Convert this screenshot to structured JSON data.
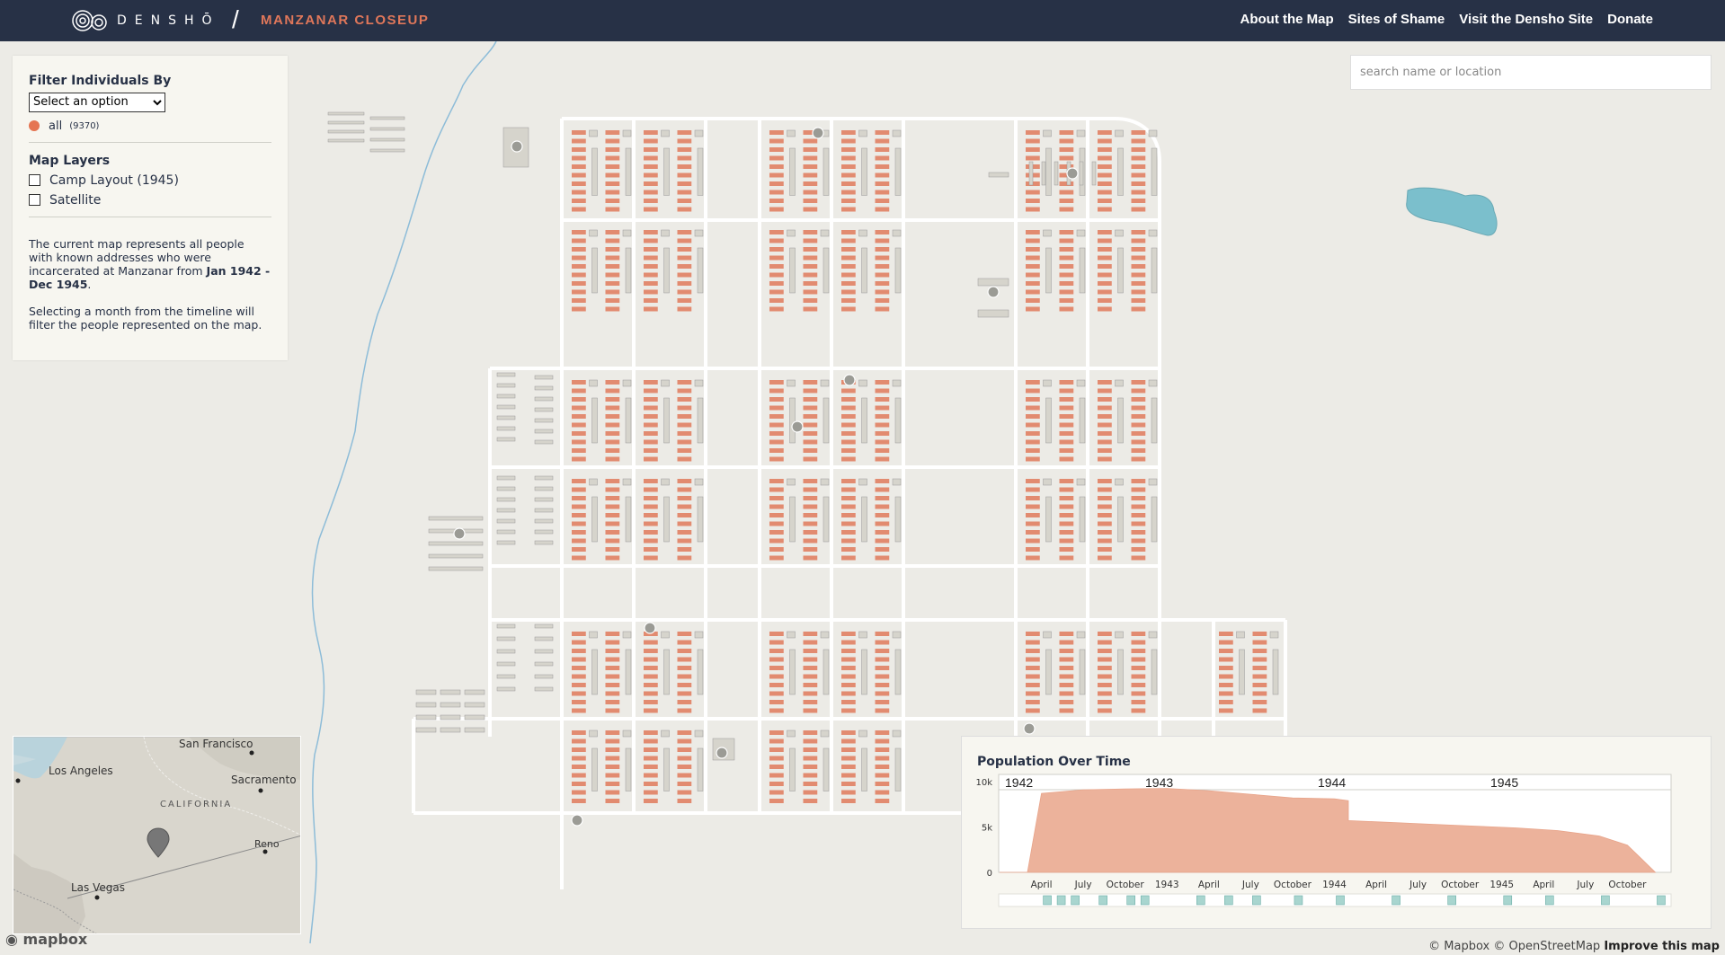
{
  "header": {
    "brand": "DENSHŌ",
    "app_title": "MANZANAR CLOSEUP",
    "nav": [
      "About the Map",
      "Sites of Shame",
      "Visit the Densho Site",
      "Donate"
    ]
  },
  "filter_panel": {
    "title": "Filter Individuals By",
    "select_value": "Select an option",
    "all_label": "all",
    "all_count": "(9370)",
    "layers_title": "Map Layers",
    "layers": [
      "Camp Layout (1945)",
      "Satellite"
    ],
    "description_1_prefix": "The current map represents all people with known addresses who were incarcerated at Manzanar from ",
    "description_1_range": "Jan 1942 - Dec 1945",
    "description_1_suffix": ".",
    "description_2": "Selecting a month from the timeline will filter the people represented on the map."
  },
  "search": {
    "placeholder": "search name or location"
  },
  "inset_map": {
    "labels": [
      "San Francisco",
      "Los Angeles",
      "Sacramento",
      "CALIFORNIA",
      "Reno",
      "Las Vegas"
    ]
  },
  "mapbox_logo": "mapbox",
  "chart_data": {
    "type": "area",
    "title": "Population Over Time",
    "years": [
      "1942",
      "1943",
      "1944",
      "1945"
    ],
    "month_ticks": [
      "April",
      "July",
      "October",
      "1943",
      "April",
      "July",
      "October",
      "1944",
      "April",
      "July",
      "October",
      "1945",
      "April",
      "July",
      "October"
    ],
    "y_ticks": [
      "10k",
      "5k",
      "0"
    ],
    "ylim": [
      0,
      10000
    ],
    "x_start": "1942-01",
    "series": [
      {
        "values": [
          {
            "x": "1942-01",
            "y": 0
          },
          {
            "x": "1942-03",
            "y": 0
          },
          {
            "x": "1942-04",
            "y": 8700
          },
          {
            "x": "1942-07",
            "y": 9100
          },
          {
            "x": "1942-10",
            "y": 9200
          },
          {
            "x": "1943-01",
            "y": 9250
          },
          {
            "x": "1943-04",
            "y": 9000
          },
          {
            "x": "1943-07",
            "y": 8600
          },
          {
            "x": "1943-10",
            "y": 8200
          },
          {
            "x": "1944-01",
            "y": 8100
          },
          {
            "x": "1944-02",
            "y": 7900
          },
          {
            "x": "1944-02",
            "y": 5700
          },
          {
            "x": "1944-05",
            "y": 5500
          },
          {
            "x": "1944-08",
            "y": 5300
          },
          {
            "x": "1944-11",
            "y": 5100
          },
          {
            "x": "1945-02",
            "y": 4900
          },
          {
            "x": "1945-05",
            "y": 4600
          },
          {
            "x": "1945-08",
            "y": 4000
          },
          {
            "x": "1945-10",
            "y": 3000
          },
          {
            "x": "1945-11",
            "y": 1500
          },
          {
            "x": "1945-12",
            "y": 0
          }
        ]
      }
    ],
    "colors": {
      "area": "#ecb29b",
      "event": "#a8d5cf"
    }
  },
  "attribution": {
    "mapbox": "© Mapbox",
    "osm": "© OpenStreetMap",
    "improve": "Improve this map"
  },
  "colors": {
    "nav_bg": "#273146",
    "accent": "#e0775a",
    "dot": "#e57552",
    "lake": "#7bbfcc",
    "river": "#8dbcd8"
  }
}
